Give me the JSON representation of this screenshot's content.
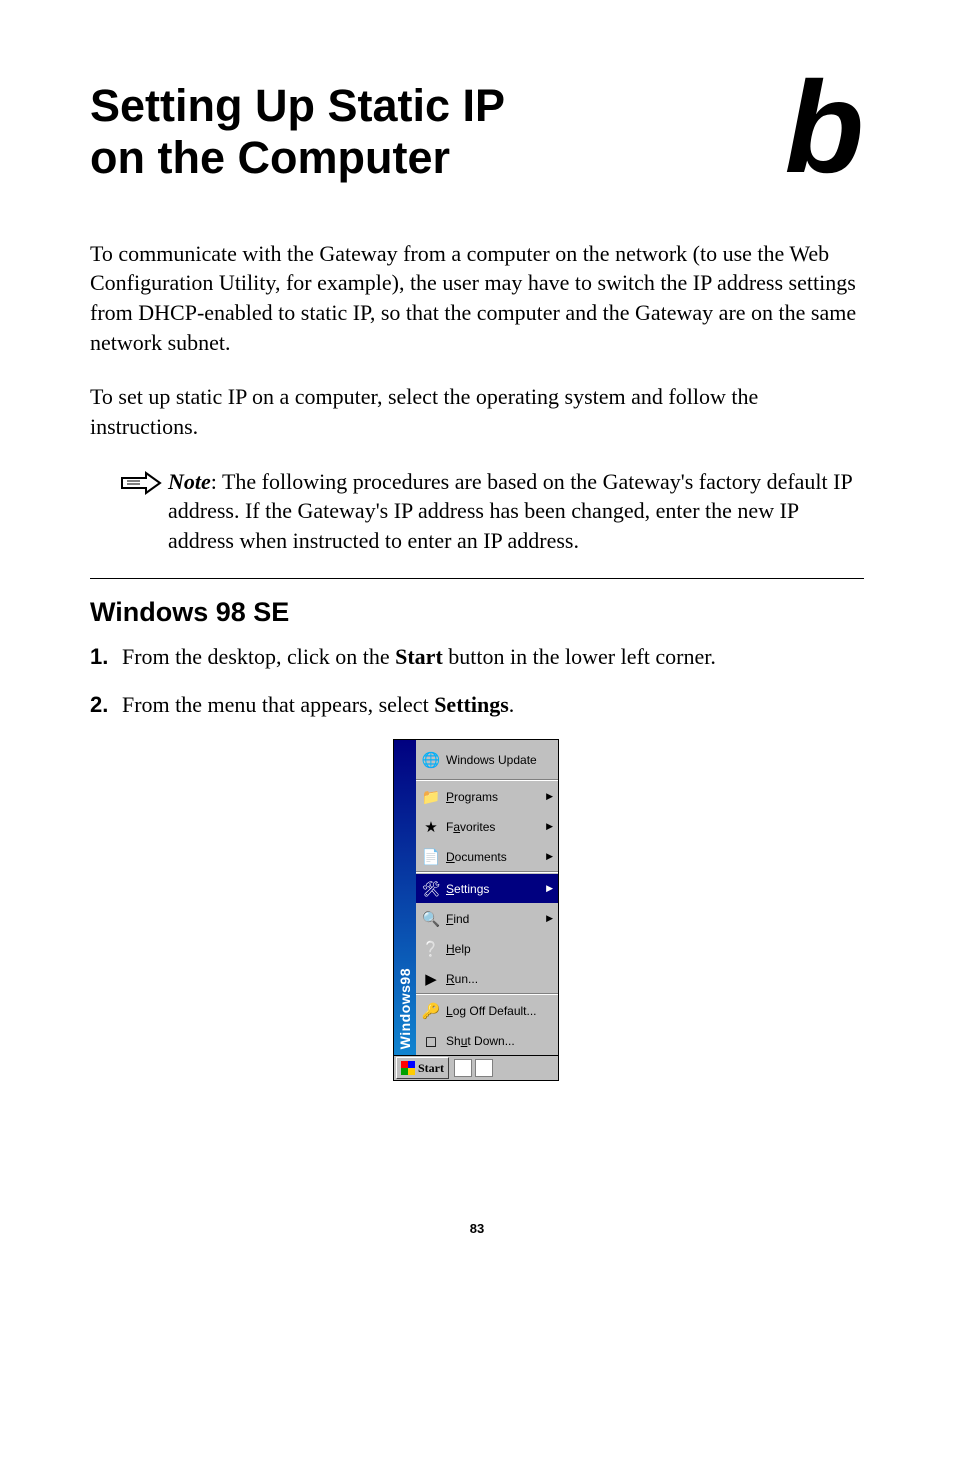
{
  "chapter": {
    "title_line1": "Setting Up Static IP",
    "title_line2": "on the Computer",
    "letter": "b"
  },
  "intro": {
    "p1": "To communicate with the Gateway from a computer on the network (to use the Web Configuration Utility, for example), the user may have to switch the IP address settings from DHCP-enabled to static IP, so that the computer and the Gateway are on the same network subnet.",
    "p2": "To set up static IP on a computer, select the operating system and follow the instructions."
  },
  "note": {
    "label": "Note",
    "text": ": The following procedures are based on the Gateway's factory default IP address. If the Gateway's IP address has been changed, enter the new IP address when instructed to enter an IP address."
  },
  "section": {
    "heading": "Windows 98 SE",
    "steps": [
      {
        "num": "1.",
        "prefix": "From the desktop, click on the ",
        "bold": "Start",
        "suffix": " button in the lower left corner."
      },
      {
        "num": "2.",
        "prefix": "From the menu that appears, select ",
        "bold": "Settings",
        "suffix": "."
      }
    ]
  },
  "start_menu": {
    "sidebar": "Windows98",
    "items": [
      {
        "label": "Windows Update",
        "u": "",
        "arrow": false,
        "tall": true,
        "sel": false
      },
      {
        "label": "Programs",
        "u": "P",
        "arrow": true,
        "tall": false,
        "sel": false,
        "divider_before": true
      },
      {
        "label": "Favorites",
        "u": "a",
        "arrow": true,
        "tall": false,
        "sel": false
      },
      {
        "label": "Documents",
        "u": "D",
        "arrow": true,
        "tall": false,
        "sel": false
      },
      {
        "label": "Settings",
        "u": "S",
        "arrow": true,
        "tall": false,
        "sel": true,
        "divider_before": true
      },
      {
        "label": "Find",
        "u": "F",
        "arrow": true,
        "tall": false,
        "sel": false
      },
      {
        "label": "Help",
        "u": "H",
        "arrow": false,
        "tall": false,
        "sel": false
      },
      {
        "label": "Run...",
        "u": "R",
        "arrow": false,
        "tall": false,
        "sel": false
      },
      {
        "label": "Log Off Default...",
        "u": "L",
        "arrow": false,
        "tall": false,
        "sel": false,
        "divider_before": true
      },
      {
        "label": "Shut Down...",
        "u": "u",
        "arrow": false,
        "tall": false,
        "sel": false
      }
    ],
    "taskbar_start": "Start"
  },
  "page_number": "83"
}
